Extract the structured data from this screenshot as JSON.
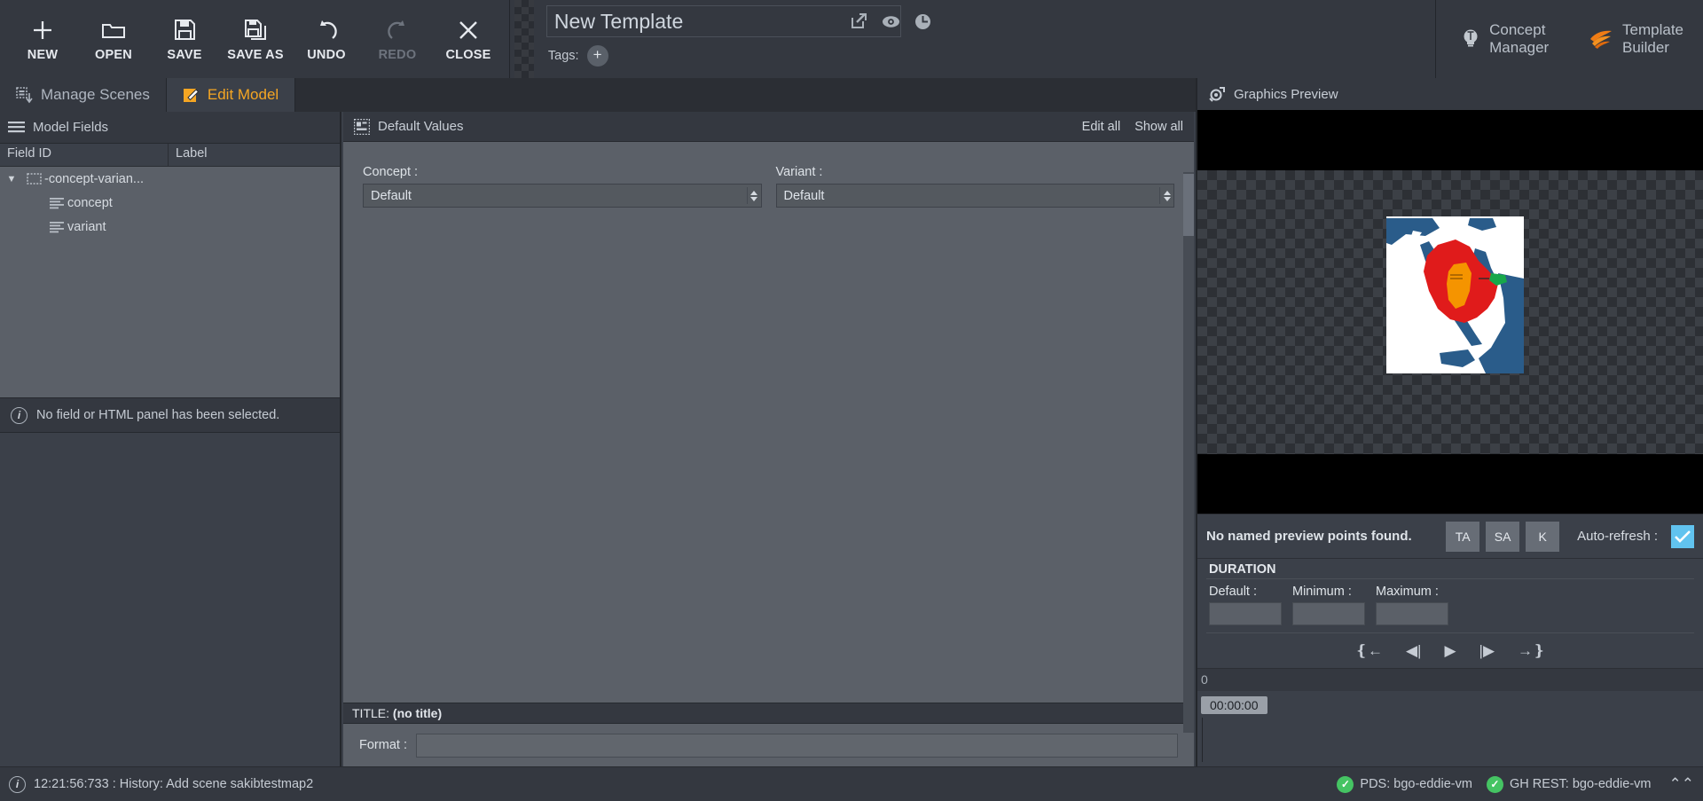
{
  "toolbar": {
    "buttons": [
      {
        "label": "NEW",
        "icon": "plus-icon",
        "disabled": false
      },
      {
        "label": "OPEN",
        "icon": "folder-icon",
        "disabled": false
      },
      {
        "label": "SAVE",
        "icon": "floppy-disk-icon",
        "disabled": false
      },
      {
        "label": "SAVE AS",
        "icon": "floppy-disk-copy-icon",
        "disabled": false
      },
      {
        "label": "UNDO",
        "icon": "undo-arrow-icon",
        "disabled": false
      },
      {
        "label": "REDO",
        "icon": "redo-arrow-icon",
        "disabled": true
      },
      {
        "label": "CLOSE",
        "icon": "close-x-icon",
        "disabled": false
      }
    ],
    "template_title": "New Template",
    "template_title_placeholder": "Template name",
    "tags_label": "Tags:",
    "tag_add_label": "+",
    "header_icons": [
      "external-edit-icon",
      "eye-icon",
      "clock-icon"
    ],
    "right_buttons": [
      {
        "label": "Concept Manager",
        "icon": "lightbulb-icon"
      },
      {
        "label": "Template Builder",
        "icon": "feather-icon"
      }
    ]
  },
  "tabs": [
    {
      "label": "Manage Scenes",
      "icon": "scenes-icon",
      "active": false
    },
    {
      "label": "Edit Model",
      "icon": "edit-model-icon",
      "active": true
    }
  ],
  "left_panel": {
    "title": "Model Fields",
    "title_icon": "list-lines-icon",
    "columns": [
      "Field ID",
      "Label"
    ],
    "rows": [
      {
        "label": "-concept-varian...",
        "value": "",
        "icon": "folder-dashed-icon",
        "caret": "▼",
        "level": 0
      },
      {
        "label": "concept",
        "value": "",
        "icon": "field-lines-icon",
        "caret": "",
        "level": 1
      },
      {
        "label": "variant",
        "value": "",
        "icon": "field-lines-icon",
        "caret": "",
        "level": 1
      }
    ],
    "info_message": "No field or HTML panel has been selected."
  },
  "mid_panel": {
    "title": "Default Values",
    "title_icon": "default-values-icon",
    "actions": [
      "Edit all",
      "Show all"
    ],
    "fields": [
      {
        "label": "Concept :",
        "value": "Default",
        "options": [
          "Default"
        ]
      },
      {
        "label": "Variant :",
        "value": "Default",
        "options": [
          "Default"
        ]
      }
    ],
    "title_strip_prefix": "TITLE:",
    "title_strip_value": "(no title)",
    "format_label": "Format :",
    "format_value": "",
    "format_placeholder": ""
  },
  "right_panel": {
    "title": "Graphics Preview",
    "title_icon": "preview-target-icon",
    "preview_message": "No named preview points found.",
    "preview_buttons": [
      "TA",
      "SA",
      "K"
    ],
    "auto_refresh_label": "Auto-refresh :",
    "auto_refresh_checked": true,
    "duration_title": "DURATION",
    "duration_fields": [
      {
        "label": "Default :",
        "value": ""
      },
      {
        "label": "Minimum :",
        "value": ""
      },
      {
        "label": "Maximum :",
        "value": ""
      }
    ],
    "transport": [
      {
        "name": "go-to-start-icon",
        "glyph": "❴←"
      },
      {
        "name": "step-back-icon",
        "glyph": "◀|"
      },
      {
        "name": "play-icon",
        "glyph": "▶"
      },
      {
        "name": "step-forward-icon",
        "glyph": "|▶"
      },
      {
        "name": "go-to-end-icon",
        "glyph": "→❵"
      }
    ],
    "timeline_tick": "0",
    "timecode": "00:00:00"
  },
  "statusbar": {
    "message": "12:21:56:733 : History: Add scene sakibtestmap2",
    "connections": [
      {
        "label": "PDS: bgo-eddie-vm",
        "status": "ok"
      },
      {
        "label": "GH REST: bgo-eddie-vm",
        "status": "ok"
      }
    ],
    "expand_icon": "chevron-up-icon"
  },
  "colors": {
    "accent": "#f5a623",
    "panel_bg": "#3b4049",
    "toolbar_bg": "#343840",
    "field_bg": "#5b6068",
    "checkbox_blue": "#61c3ef",
    "status_ok_green": "#45c463",
    "map_highlight_red": "#e01b1b",
    "map_highlight_orange": "#f59400",
    "map_water_blue": "#2a5c8a",
    "map_green": "#17a84a"
  }
}
